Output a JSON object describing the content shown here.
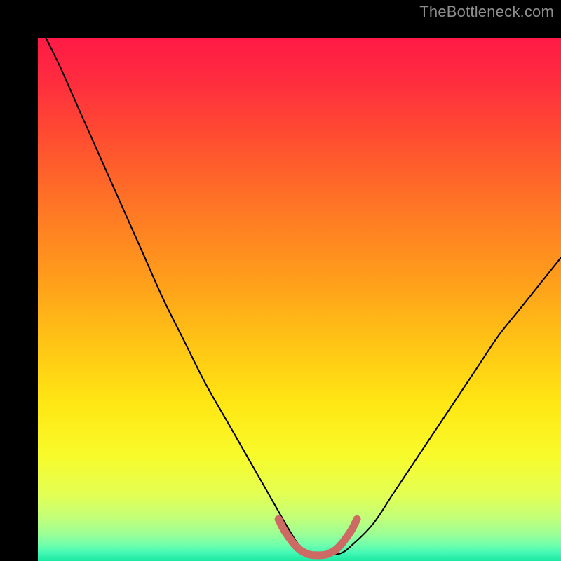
{
  "watermark": {
    "text": "TheBottleneck.com"
  },
  "chart_data": {
    "type": "line",
    "title": "",
    "xlabel": "",
    "ylabel": "",
    "xlim": [
      0,
      100
    ],
    "ylim": [
      0,
      100
    ],
    "grid": false,
    "series": [
      {
        "name": "curve",
        "x": [
          0,
          4,
          8,
          12,
          16,
          20,
          24,
          28,
          32,
          36,
          40,
          44,
          48,
          50,
          52,
          54,
          56,
          58,
          60,
          64,
          68,
          72,
          76,
          80,
          84,
          88,
          92,
          96,
          100
        ],
        "y": [
          103,
          95,
          86,
          77,
          68,
          59,
          50,
          42,
          34,
          27,
          20,
          13,
          6,
          3,
          1.5,
          1.2,
          1.2,
          1.5,
          3,
          7,
          13,
          19,
          25,
          31,
          37,
          43,
          48,
          53,
          58
        ]
      },
      {
        "name": "bottom-highlight",
        "x": [
          46,
          47,
          48,
          49,
          50,
          51,
          52,
          53,
          54,
          55,
          56,
          57,
          58,
          59,
          60,
          61
        ],
        "y": [
          8,
          6,
          4.5,
          3.2,
          2.2,
          1.6,
          1.2,
          1.1,
          1.1,
          1.2,
          1.6,
          2.2,
          3.2,
          4.5,
          6,
          8
        ]
      }
    ],
    "gradient_stops": [
      {
        "offset": 0.0,
        "color": "#FF1A46"
      },
      {
        "offset": 0.08,
        "color": "#FF2C3F"
      },
      {
        "offset": 0.18,
        "color": "#FF4A32"
      },
      {
        "offset": 0.3,
        "color": "#FF6F27"
      },
      {
        "offset": 0.45,
        "color": "#FF9A1C"
      },
      {
        "offset": 0.58,
        "color": "#FFC315"
      },
      {
        "offset": 0.7,
        "color": "#FFE714"
      },
      {
        "offset": 0.8,
        "color": "#F8FB2B"
      },
      {
        "offset": 0.875,
        "color": "#E2FF55"
      },
      {
        "offset": 0.918,
        "color": "#C2FF79"
      },
      {
        "offset": 0.948,
        "color": "#9CFF95"
      },
      {
        "offset": 0.968,
        "color": "#73FFAB"
      },
      {
        "offset": 0.984,
        "color": "#45F9B5"
      },
      {
        "offset": 1.0,
        "color": "#19E8A1"
      }
    ],
    "colors": {
      "curve_stroke": "#000000",
      "highlight_stroke": "#CE6A64"
    }
  }
}
